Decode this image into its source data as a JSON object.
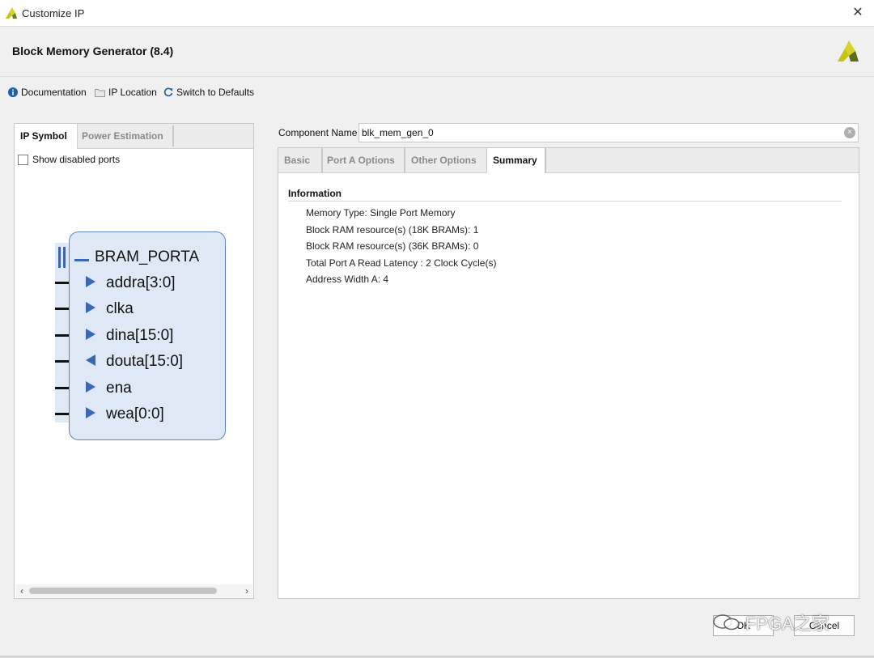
{
  "window": {
    "title": "Customize IP",
    "close_glyph": "✕"
  },
  "header": {
    "ip_title": "Block Memory Generator (8.4)",
    "logo": "vivado-logo"
  },
  "toolbar": {
    "items": [
      {
        "label": "Documentation",
        "icon": "info-icon"
      },
      {
        "label": "IP Location",
        "icon": "folder-icon"
      },
      {
        "label": "Switch to Defaults",
        "icon": "refresh-icon"
      }
    ]
  },
  "left_panel": {
    "tabs": [
      {
        "label": "IP Symbol",
        "active": true
      },
      {
        "label": "Power Estimation",
        "active": false
      }
    ],
    "show_disabled_ports": {
      "label": "Show disabled ports",
      "checked": false
    },
    "symbol": {
      "bus_label": "BRAM_PORTA",
      "ports": [
        {
          "name": "addra[3:0]",
          "direction": "input"
        },
        {
          "name": "clka",
          "direction": "input"
        },
        {
          "name": "dina[15:0]",
          "direction": "input"
        },
        {
          "name": "douta[15:0]",
          "direction": "output"
        },
        {
          "name": "ena",
          "direction": "input"
        },
        {
          "name": "wea[0:0]",
          "direction": "input"
        }
      ]
    },
    "scroll": {
      "left_glyph": "‹",
      "right_glyph": "›"
    }
  },
  "component": {
    "label": "Component Name",
    "value": "blk_mem_gen_0",
    "clear_glyph": "×"
  },
  "right_panel": {
    "tabs": [
      {
        "label": "Basic",
        "active": false
      },
      {
        "label": "Port A Options",
        "active": false
      },
      {
        "label": "Other Options",
        "active": false
      },
      {
        "label": "Summary",
        "active": true
      }
    ],
    "section_title": "Information",
    "info_lines": [
      "Memory Type: Single Port Memory",
      "Block RAM resource(s) (18K BRAMs): 1",
      "Block RAM resource(s) (36K BRAMs): 0",
      "Total Port A Read Latency : 2 Clock Cycle(s)",
      "Address Width A: 4"
    ]
  },
  "buttons": {
    "ok": "OK",
    "cancel": "Cancel"
  },
  "watermark": {
    "text": "FPGA之家"
  },
  "colors": {
    "accent": "#3b67b5",
    "symbol_fill": "#dfe9f5",
    "logo_yellow": "#c6c317",
    "logo_green": "#5a6e1a"
  }
}
